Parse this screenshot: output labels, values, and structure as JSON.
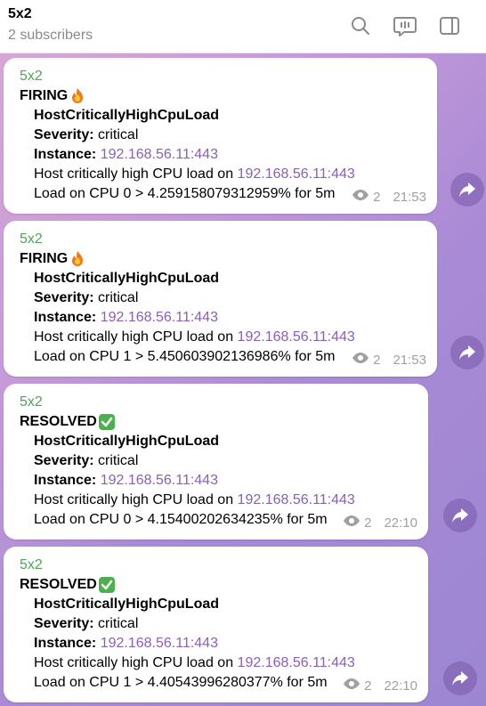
{
  "header": {
    "title": "5x2",
    "subtitle": "2 subscribers",
    "icons": [
      "search-icon",
      "discussion-icon",
      "sidebar-toggle-icon"
    ]
  },
  "colors": {
    "sender": "#4ca65a",
    "link": "#8a5fb5",
    "meta": "#a0a0a0"
  },
  "messages": [
    {
      "sender": "5x2",
      "status": "FIRING",
      "status_icon": "fire-icon",
      "alert": "HostCriticallyHighCpuLoad",
      "severity_label": "Severity:",
      "severity": "critical",
      "instance_label": "Instance:",
      "instance": "192.168.56.11:443",
      "desc_text": "Host critically high CPU load on",
      "desc_link": "192.168.56.11:443",
      "load": "Load on CPU 0 > 4.259158079312959% for 5m",
      "views": "2",
      "time": "21:53"
    },
    {
      "sender": "5x2",
      "status": "FIRING",
      "status_icon": "fire-icon",
      "alert": "HostCriticallyHighCpuLoad",
      "severity_label": "Severity:",
      "severity": "critical",
      "instance_label": "Instance:",
      "instance": "192.168.56.11:443",
      "desc_text": "Host critically high CPU load on",
      "desc_link": "192.168.56.11:443",
      "load": "Load on CPU 1 > 5.450603902136986% for 5m",
      "views": "2",
      "time": "21:53"
    },
    {
      "sender": "5x2",
      "status": "RESOLVED",
      "status_icon": "check-mark-icon",
      "alert": "HostCriticallyHighCpuLoad",
      "severity_label": "Severity:",
      "severity": "critical",
      "instance_label": "Instance:",
      "instance": "192.168.56.11:443",
      "desc_text": "Host critically high CPU load on",
      "desc_link": "192.168.56.11:443",
      "load": "Load on CPU 0 > 4.15400202634235% for 5m",
      "views": "2",
      "time": "22:10"
    },
    {
      "sender": "5x2",
      "status": "RESOLVED",
      "status_icon": "check-mark-icon",
      "alert": "HostCriticallyHighCpuLoad",
      "severity_label": "Severity:",
      "severity": "critical",
      "instance_label": "Instance:",
      "instance": "192.168.56.11:443",
      "desc_text": "Host critically high CPU load on",
      "desc_link": "192.168.56.11:443",
      "load": "Load on CPU 1 > 4.40543996280377% for 5m",
      "views": "2",
      "time": "22:10"
    }
  ]
}
